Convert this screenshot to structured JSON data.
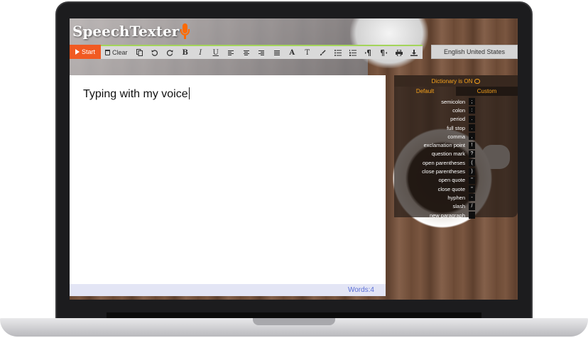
{
  "app": {
    "logo_text": "SpeechTexter"
  },
  "toolbar": {
    "start_label": "Start",
    "clear_label": "Clear",
    "bold_label": "B",
    "italic_label": "I",
    "underline_label": "U",
    "font_label": "A",
    "font_size_label": "T",
    "language": "English United States",
    "icons": [
      "copy-icon",
      "undo-icon",
      "redo-icon",
      "bold-icon",
      "italic-icon",
      "underline-icon",
      "align-left-icon",
      "align-center-icon",
      "align-right-icon",
      "align-justify-icon",
      "font-color-icon",
      "font-size-icon",
      "brush-icon",
      "bullet-list-icon",
      "numbered-list-icon",
      "ltr-icon",
      "rtl-icon",
      "print-icon",
      "download-icon"
    ]
  },
  "editor": {
    "text": "Typing with my voice",
    "words_label": "Words:4"
  },
  "dictionary": {
    "status": "Dictionary is ON",
    "tabs": [
      "Default",
      "Custom"
    ],
    "entries": [
      {
        "label": "semicolon",
        "symbol": ";"
      },
      {
        "label": "colon",
        "symbol": ":"
      },
      {
        "label": "period",
        "symbol": "."
      },
      {
        "label": "full stop",
        "symbol": "."
      },
      {
        "label": "comma",
        "symbol": ","
      },
      {
        "label": "exclamation point",
        "symbol": "!"
      },
      {
        "label": "question mark",
        "symbol": "?"
      },
      {
        "label": "open parentheses",
        "symbol": "("
      },
      {
        "label": "close parentheses",
        "symbol": ")"
      },
      {
        "label": "open quote",
        "symbol": "\""
      },
      {
        "label": "close quote",
        "symbol": "\""
      },
      {
        "label": "hyphen",
        "symbol": "-"
      },
      {
        "label": "slash",
        "symbol": "/"
      },
      {
        "label": "new paragraph",
        "symbol": ""
      }
    ]
  },
  "colors": {
    "accent": "#f15a22",
    "toolbar_border": "#a3d45a",
    "dict_text": "#f7a21b",
    "word_count": "#5a6fd6"
  }
}
